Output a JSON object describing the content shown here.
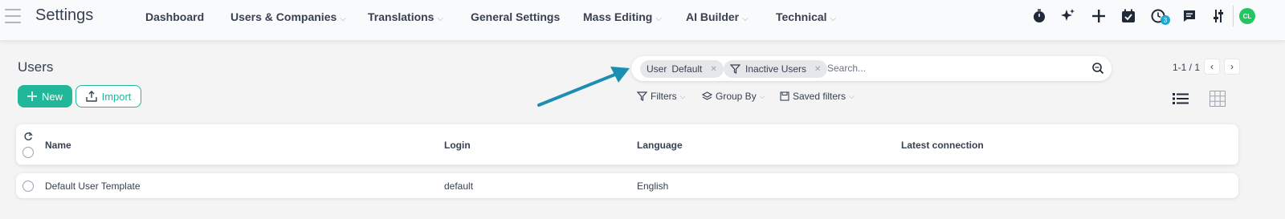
{
  "header": {
    "app_title": "Settings",
    "menu": [
      {
        "label": "Dashboard",
        "dropdown": false
      },
      {
        "label": "Users & Companies",
        "dropdown": true
      },
      {
        "label": "Translations",
        "dropdown": true
      },
      {
        "label": "General Settings",
        "dropdown": false
      },
      {
        "label": "Mass Editing",
        "dropdown": true
      },
      {
        "label": "AI Builder",
        "dropdown": true
      },
      {
        "label": "Technical",
        "dropdown": true
      }
    ],
    "systray": {
      "icons": [
        "stopwatch-icon",
        "sparkle-icon",
        "plus-icon",
        "calendar-check-icon",
        "clock-icon",
        "chat-icon",
        "sliders-icon"
      ],
      "activity_badge": "3",
      "avatar_initials": "CL",
      "avatar_color": "#22c55e"
    }
  },
  "page": {
    "title": "Users",
    "new_label": "New",
    "import_label": "Import",
    "accent_color": "#21b799"
  },
  "search": {
    "facets": [
      {
        "category": "User",
        "value": "Default",
        "icon": null
      },
      {
        "category": null,
        "value": "Inactive Users",
        "icon": "filter-icon"
      }
    ],
    "placeholder": "Search...",
    "filters_label": "Filters",
    "group_by_label": "Group By",
    "saved_filters_label": "Saved filters"
  },
  "pager": {
    "label": "1-1 / 1"
  },
  "view_switcher": {
    "active": "list",
    "options": [
      "list-view-icon",
      "kanban-grid-icon"
    ]
  },
  "table": {
    "columns": [
      "Name",
      "Login",
      "Language",
      "Latest connection"
    ],
    "rows": [
      {
        "name": "Default User Template",
        "login": "default",
        "language": "English",
        "latest_connection": ""
      }
    ]
  },
  "annotation": {
    "arrow_color": "#1a8fb2"
  }
}
